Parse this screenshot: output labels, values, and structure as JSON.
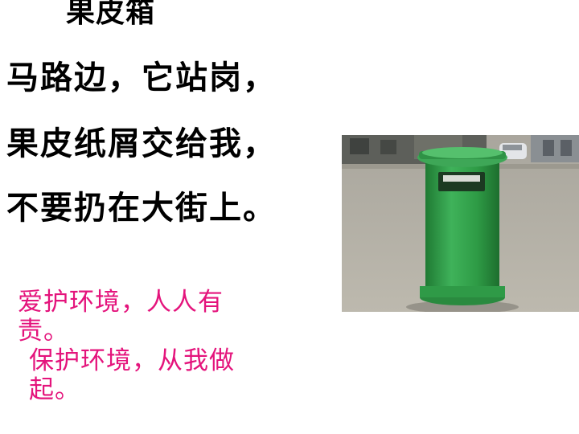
{
  "heading": "果皮箱",
  "poem": [
    "马路边，它站岗，",
    "果皮纸屑交给我，",
    "不要扔在大街上。"
  ],
  "slogans": [
    "爱护环境，人人有责。",
    "保护环境，从我做起。"
  ],
  "colors": {
    "slogan": "#e4147c",
    "bin": "#2e9b45"
  }
}
